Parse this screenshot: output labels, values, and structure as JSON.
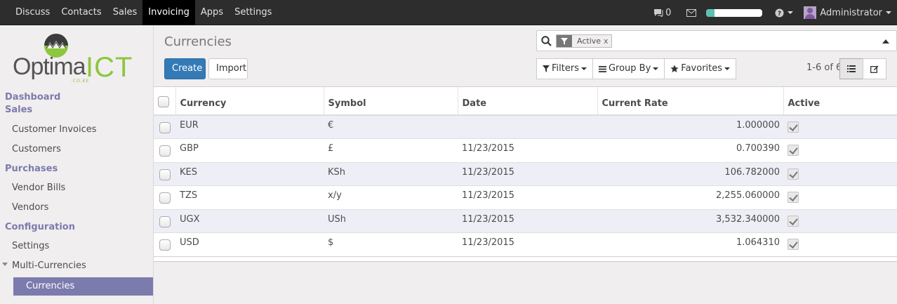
{
  "topbar": {
    "menu": [
      "Discuss",
      "Contacts",
      "Sales",
      "Invoicing",
      "Apps",
      "Settings"
    ],
    "active_menu": "Invoicing",
    "messages_count": "0",
    "progress_percent": 15,
    "user": "Administrator"
  },
  "logo": {
    "part1": "Optima",
    "part2": "ICT",
    "part3": ".CO.KE"
  },
  "sidebar": {
    "dashboard": "Dashboard",
    "sales_header": "Sales",
    "customer_invoices": "Customer Invoices",
    "customers": "Customers",
    "purchases_header": "Purchases",
    "vendor_bills": "Vendor Bills",
    "vendors": "Vendors",
    "configuration_header": "Configuration",
    "settings": "Settings",
    "multi_currencies": "Multi-Currencies",
    "currencies": "Currencies"
  },
  "control_panel": {
    "title": "Currencies",
    "create_label": "Create",
    "import_label": "Import",
    "facet_label": "Active",
    "facet_remove": "x",
    "filters_label": "Filters",
    "group_by_label": "Group By",
    "favorites_label": "Favorites",
    "pager": "1-6 of 6"
  },
  "table": {
    "columns": [
      "Currency",
      "Symbol",
      "Date",
      "Current Rate",
      "Active"
    ],
    "rows": [
      {
        "currency": "EUR",
        "symbol": "€",
        "date": "",
        "rate": "1.000000",
        "active": true
      },
      {
        "currency": "GBP",
        "symbol": "£",
        "date": "11/23/2015",
        "rate": "0.700390",
        "active": true
      },
      {
        "currency": "KES",
        "symbol": "KSh",
        "date": "11/23/2015",
        "rate": "106.782000",
        "active": true
      },
      {
        "currency": "TZS",
        "symbol": "x/y",
        "date": "11/23/2015",
        "rate": "2,255.060000",
        "active": true
      },
      {
        "currency": "UGX",
        "symbol": "USh",
        "date": "11/23/2015",
        "rate": "3,532.340000",
        "active": true
      },
      {
        "currency": "USD",
        "symbol": "$",
        "date": "11/23/2015",
        "rate": "1.064310",
        "active": true
      }
    ]
  },
  "colors": {
    "topbar_bg": "#2d2d2d",
    "accent": "#7c7bad",
    "primary_button": "#337ab7",
    "logo_green": "#8dc63f"
  }
}
